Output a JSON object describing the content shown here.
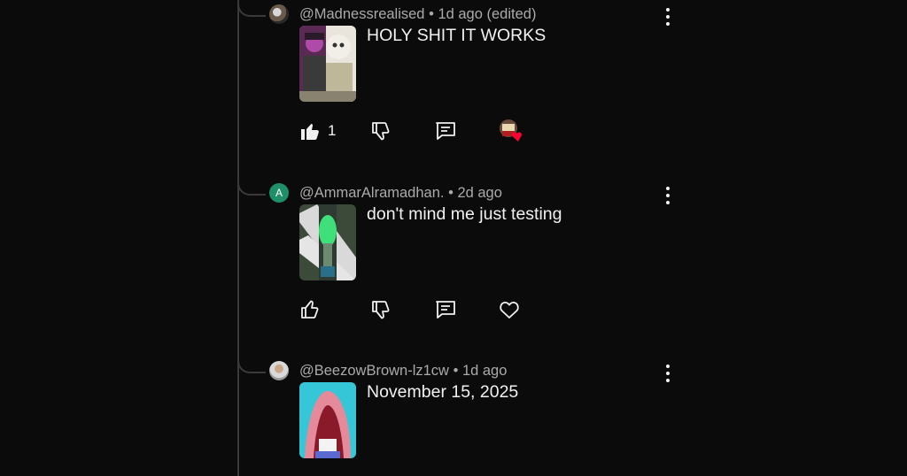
{
  "comments": [
    {
      "handle": "@Madnessrealised",
      "time": "• 1d ago (edited)",
      "text": "HOLY SHIT IT WORKS",
      "likes": "1",
      "avatar_letter": "",
      "liked_by_creator": true,
      "icons": [
        "thumbs-up-filled-icon",
        "thumbs-down-icon",
        "reply-icon",
        "creator-heart-avatar-icon"
      ]
    },
    {
      "handle": "@AmmarAlramadhan.",
      "time": "• 2d ago",
      "text": "don't mind me just testing",
      "likes": "",
      "avatar_letter": "A",
      "liked_by_creator": false,
      "icons": [
        "thumbs-up-icon",
        "thumbs-down-icon",
        "reply-icon",
        "heart-outline-icon"
      ]
    },
    {
      "handle": "@BeezowBrown-lz1cw",
      "time": "• 1d ago",
      "text": "November 15, 2025",
      "likes": "",
      "avatar_letter": "",
      "liked_by_creator": false,
      "icons": []
    }
  ],
  "colors": {
    "background": "#0b0b0b",
    "thread_line": "#3a3a3a",
    "meta_text": "#aaaaaa",
    "primary_text": "#f1f1f1",
    "avatar_green": "#1f8f6a",
    "heart_red": "#ff0033"
  }
}
